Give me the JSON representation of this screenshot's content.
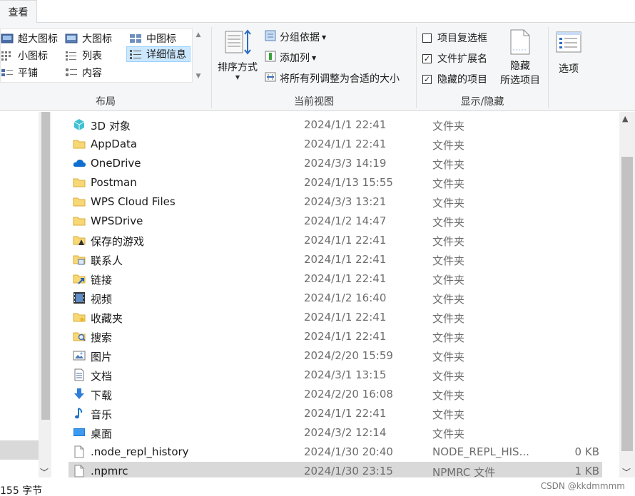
{
  "ribbon": {
    "tab_view": "查看",
    "layout": {
      "items": [
        "超大图标",
        "大图标",
        "中图标",
        "小图标",
        "列表",
        "详细信息",
        "平铺",
        "内容"
      ],
      "selected": "详细信息",
      "group_label": "布局"
    },
    "current_view": {
      "sort_by": "排序方式",
      "group_by": "分组依据",
      "add_column": "添加列",
      "fit_columns": "将所有列调整为合适的大小",
      "group_label": "当前视图"
    },
    "show_hide": {
      "item_checkboxes": "项目复选框",
      "item_checkboxes_checked": false,
      "file_extensions": "文件扩展名",
      "file_extensions_checked": true,
      "hidden_items": "隐藏的项目",
      "hidden_items_checked": true,
      "hide_selected_line1": "隐藏",
      "hide_selected_line2": "所选项目",
      "group_label": "显示/隐藏"
    },
    "options": "选项"
  },
  "files": [
    {
      "name": "3D 对象",
      "date": "2024/1/1 22:41",
      "type": "文件夹",
      "size": "",
      "icon": "3d-objects-icon"
    },
    {
      "name": "AppData",
      "date": "2024/1/1 22:41",
      "type": "文件夹",
      "size": "",
      "icon": "folder-icon"
    },
    {
      "name": "OneDrive",
      "date": "2024/3/3 14:19",
      "type": "文件夹",
      "size": "",
      "icon": "onedrive-cloud-icon"
    },
    {
      "name": "Postman",
      "date": "2024/1/13 15:55",
      "type": "文件夹",
      "size": "",
      "icon": "folder-icon"
    },
    {
      "name": "WPS Cloud Files",
      "date": "2024/3/3 13:21",
      "type": "文件夹",
      "size": "",
      "icon": "folder-icon"
    },
    {
      "name": "WPSDrive",
      "date": "2024/1/2 14:47",
      "type": "文件夹",
      "size": "",
      "icon": "folder-icon"
    },
    {
      "name": "保存的游戏",
      "date": "2024/1/1 22:41",
      "type": "文件夹",
      "size": "",
      "icon": "saved-games-icon"
    },
    {
      "name": "联系人",
      "date": "2024/1/1 22:41",
      "type": "文件夹",
      "size": "",
      "icon": "contacts-icon"
    },
    {
      "name": "链接",
      "date": "2024/1/1 22:41",
      "type": "文件夹",
      "size": "",
      "icon": "links-icon"
    },
    {
      "name": "视频",
      "date": "2024/1/2 16:40",
      "type": "文件夹",
      "size": "",
      "icon": "videos-icon"
    },
    {
      "name": "收藏夹",
      "date": "2024/1/1 22:41",
      "type": "文件夹",
      "size": "",
      "icon": "favorites-icon"
    },
    {
      "name": "搜索",
      "date": "2024/1/1 22:41",
      "type": "文件夹",
      "size": "",
      "icon": "searches-icon"
    },
    {
      "name": "图片",
      "date": "2024/2/20 15:59",
      "type": "文件夹",
      "size": "",
      "icon": "pictures-icon"
    },
    {
      "name": "文档",
      "date": "2024/3/1 13:15",
      "type": "文件夹",
      "size": "",
      "icon": "documents-icon"
    },
    {
      "name": "下载",
      "date": "2024/2/20 16:08",
      "type": "文件夹",
      "size": "",
      "icon": "downloads-icon"
    },
    {
      "name": "音乐",
      "date": "2024/1/1 22:41",
      "type": "文件夹",
      "size": "",
      "icon": "music-icon"
    },
    {
      "name": "桌面",
      "date": "2024/3/2 12:14",
      "type": "文件夹",
      "size": "",
      "icon": "desktop-icon"
    },
    {
      "name": ".node_repl_history",
      "date": "2024/1/30 20:40",
      "type": "NODE_REPL_HIS...",
      "size": "0 KB",
      "icon": "file-icon"
    },
    {
      "name": ".npmrc",
      "date": "2024/1/30 23:15",
      "type": "NPMRC 文件",
      "size": "1 KB",
      "icon": "file-icon",
      "selected": true
    }
  ],
  "status": {
    "text": "155 字节",
    "watermark": "CSDN @kkdmmmm"
  }
}
